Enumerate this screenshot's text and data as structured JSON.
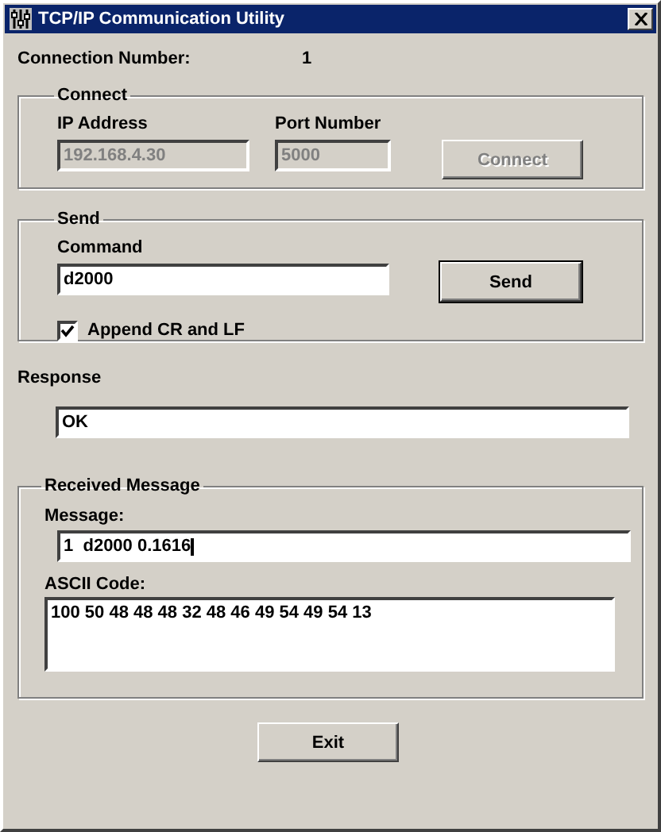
{
  "window": {
    "title": "TCP/IP Communication Utility"
  },
  "connection": {
    "label": "Connection Number:",
    "value": "1"
  },
  "connect": {
    "title": "Connect",
    "ip_label": "IP Address",
    "ip_value": "192.168.4.30",
    "port_label": "Port Number",
    "port_value": "5000",
    "button": "Connect",
    "disabled": true
  },
  "send": {
    "title": "Send",
    "command_label": "Command",
    "command_value": "d2000",
    "button": "Send",
    "append_label": "Append CR and LF",
    "append_checked": true
  },
  "response": {
    "label": "Response",
    "value": "OK"
  },
  "received": {
    "title": "Received Message",
    "message_label": "Message:",
    "message_value": "1  d2000 0.1616",
    "ascii_label": "ASCII Code:",
    "ascii_value": "100 50 48 48 48 32 48 46 49 54 49 54 13"
  },
  "exit_button": "Exit"
}
